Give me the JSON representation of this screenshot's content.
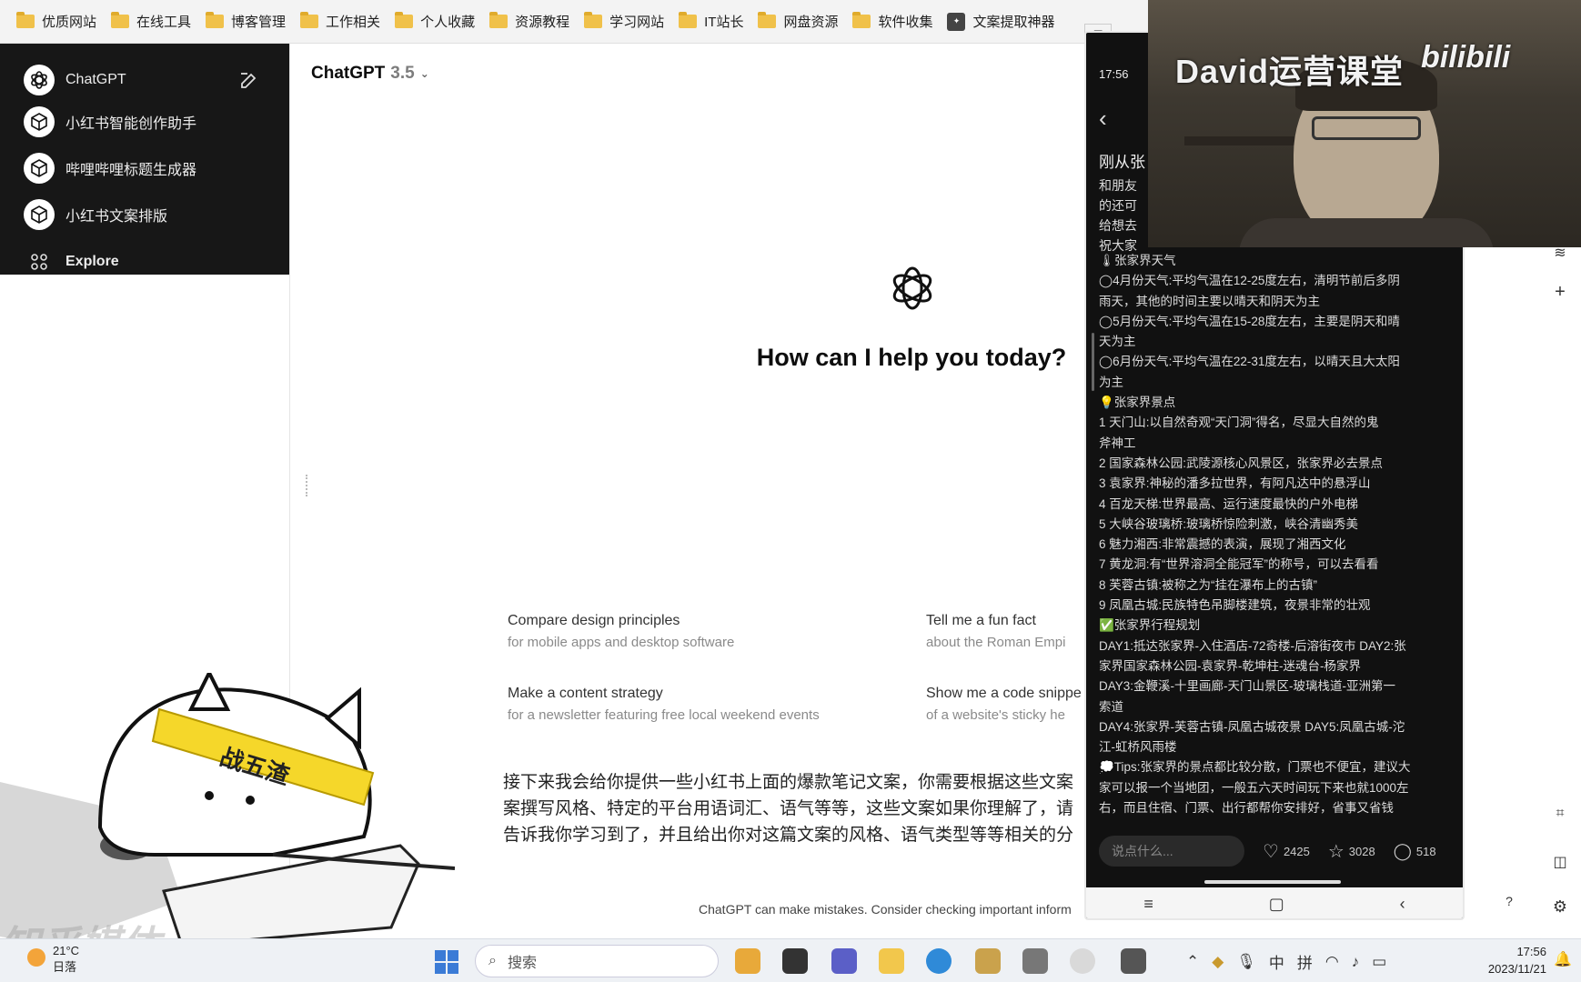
{
  "bookmarks": [
    {
      "label": "优质网站",
      "icon": "folder-icon"
    },
    {
      "label": "在线工具",
      "icon": "folder-icon"
    },
    {
      "label": "博客管理",
      "icon": "folder-icon"
    },
    {
      "label": "工作相关",
      "icon": "folder-icon"
    },
    {
      "label": "个人收藏",
      "icon": "folder-icon"
    },
    {
      "label": "资源教程",
      "icon": "folder-icon"
    },
    {
      "label": "学习网站",
      "icon": "folder-icon"
    },
    {
      "label": "IT站长",
      "icon": "folder-icon"
    },
    {
      "label": "网盘资源",
      "icon": "folder-icon"
    },
    {
      "label": "软件收集",
      "icon": "folder-icon"
    },
    {
      "label": "文案提取神器",
      "icon": "app-icon"
    }
  ],
  "sidebar": {
    "items": [
      {
        "label": "ChatGPT"
      },
      {
        "label": "小红书智能创作助手"
      },
      {
        "label": "哔哩哔哩标题生成器"
      },
      {
        "label": "小红书文案排版"
      },
      {
        "label": "Explore"
      }
    ]
  },
  "main": {
    "model_name": "ChatGPT",
    "model_version": "3.5",
    "greeting": "How can I help you today?",
    "suggestions": [
      {
        "title": "Compare design principles",
        "subtitle": "for mobile apps and desktop software"
      },
      {
        "title": "Tell me a fun fact",
        "subtitle": "about the Roman Empi"
      },
      {
        "title": "Make a content strategy",
        "subtitle": "for a newsletter featuring free local weekend events"
      },
      {
        "title": "Show me a code snippe",
        "subtitle": "of a website's sticky he"
      }
    ],
    "prompt_lines": [
      "接下来我会给你提供一些小红书上面的爆款笔记文案，你需要根据这些文案",
      "案撰写风格、特定的平台用语词汇、语气等等，这些文案如果你理解了，请",
      "告诉我你学习到了，并且给出你对这篇文案的风格、语气类型等等相关的分"
    ],
    "disclaimer": "ChatGPT can make mistakes. Consider checking important inform"
  },
  "webcam": {
    "title": "David运营课堂",
    "brand": "bilibili"
  },
  "phone": {
    "time": "17:56",
    "title_partial": "刚从张",
    "partial_lines": [
      "和朋友",
      "的还可",
      "给想去",
      "祝大家"
    ],
    "content_lines": [
      "🌡张家界天气",
      "◯4月份天气:平均气温在12-25度左右，清明节前后多阴",
      "雨天，其他的时间主要以晴天和阴天为主",
      "◯5月份天气:平均气温在15-28度左右，主要是阴天和晴",
      "天为主",
      "◯6月份天气:平均气温在22-31度左右，以晴天且大太阳",
      "为主",
      "💡张家界景点",
      "1 天门山:以自然奇观“天门洞”得名，尽显大自然的鬼",
      "斧神工",
      "2 国家森林公园:武陵源核心风景区，张家界必去景点",
      "3 袁家界:神秘的潘多拉世界，有阿凡达中的悬浮山",
      "4 百龙天梯:世界最高、运行速度最快的户外电梯",
      "5 大峡谷玻璃桥:玻璃桥惊险刺激，峡谷清幽秀美",
      "6 魅力湘西:非常震撼的表演，展现了湘西文化",
      "7 黄龙洞:有“世界溶洞全能冠军”的称号，可以去看看",
      "8 芙蓉古镇:被称之为“挂在瀑布上的古镇”",
      "9 凤凰古城:民族特色吊脚楼建筑，夜景非常的壮观",
      "✅张家界行程规划",
      "DAY1:抵达张家界-入住酒店-72奇楼-后溶街夜市 DAY2:张",
      "家界国家森林公园-袁家界-乾坤柱-迷魂台-杨家界",
      "DAY3:金鞭溪-十里画廊-天门山景区-玻璃栈道-亚洲第一",
      "索道",
      "DAY4:张家界-芙蓉古镇-凤凰古城夜景 DAY5:凤凰古城-沱",
      "江-虹桥风雨楼",
      "💭Tips:张家界的景点都比较分散，门票也不便宜，建议大",
      "家可以报一个当地团，一般五六天时间玩下来也就1000左",
      "右，而且住宿、门票、出行都帮你安排好，省事又省钱"
    ],
    "comment_placeholder": "说点什么...",
    "likes": "2425",
    "stars": "3028",
    "comments": "518"
  },
  "taskbar": {
    "temperature": "21°C",
    "weather_desc": "日落",
    "search_placeholder": "搜索",
    "ime_lang": "中",
    "ime_mode": "拼",
    "time": "17:56",
    "date": "2023/11/21"
  },
  "sticker": {
    "headband_text": "战五渣"
  },
  "watermark": "知乎媒体"
}
